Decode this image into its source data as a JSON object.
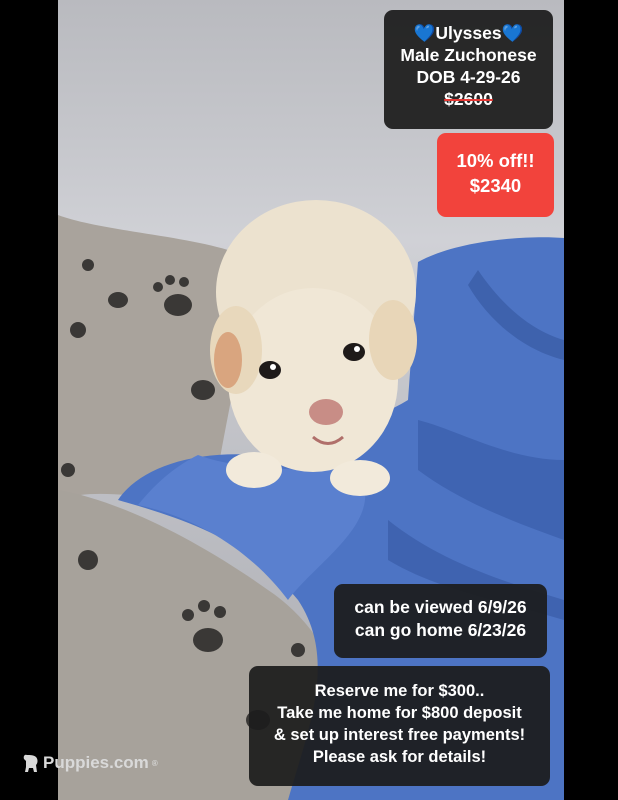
{
  "listing": {
    "heart_glyph": "💙",
    "name": "Ulysses",
    "sex_breed": "Male Zuchonese",
    "dob": "DOB 4-29-26",
    "original_price": "$2600",
    "discount_label": "10% off!!",
    "sale_price": "$2340",
    "view_date": "can be viewed 6/9/26",
    "home_date": "can go home 6/23/26",
    "reserve_line1": "Reserve me for $300..",
    "reserve_line2": "Take me home for $800 deposit",
    "reserve_line3": "& set up interest free payments!",
    "reserve_line4": "Please ask for details!"
  },
  "watermark": {
    "text": "Puppies.com",
    "mark": "®",
    "icon": "dog-icon"
  },
  "colors": {
    "sale_bg": "#f2433c",
    "caption_bg": "#1c1c1c",
    "heart": "#3ea0ef",
    "strike": "#e53935"
  }
}
